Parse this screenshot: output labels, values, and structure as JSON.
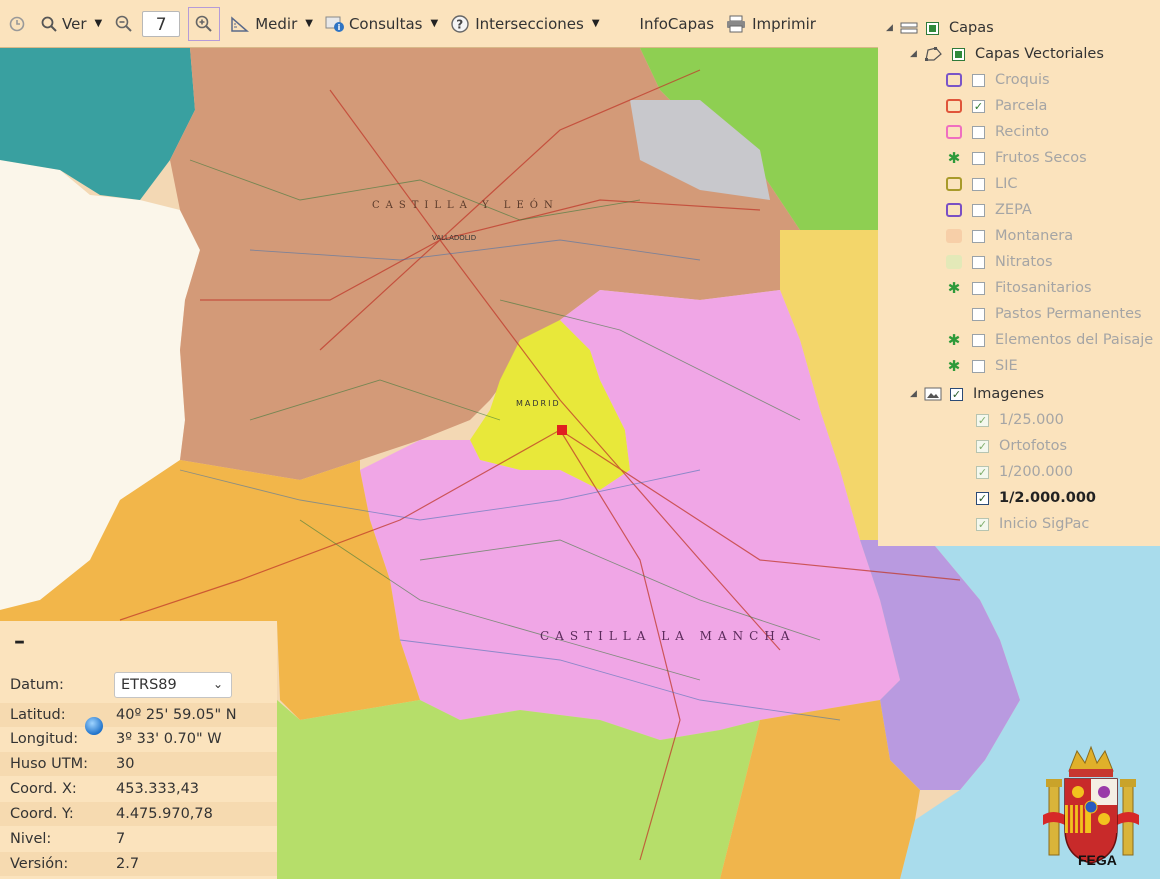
{
  "toolbar": {
    "ver_label": "Ver",
    "zoom_level": "7",
    "medir_label": "Medir",
    "consultas_label": "Consultas",
    "intersecciones_label": "Intersecciones",
    "infocapas_label": "InfoCapas",
    "imprimir_label": "Imprimir"
  },
  "layers": {
    "root_label": "Capas",
    "vector_group_label": "Capas Vectoriales",
    "vector_items": [
      {
        "label": "Croquis",
        "checked": false
      },
      {
        "label": "Parcela",
        "checked": true
      },
      {
        "label": "Recinto",
        "checked": false
      },
      {
        "label": "Frutos Secos",
        "checked": false
      },
      {
        "label": "LIC",
        "checked": false
      },
      {
        "label": "ZEPA",
        "checked": false
      },
      {
        "label": "Montanera",
        "checked": false
      },
      {
        "label": "Nitratos",
        "checked": false
      },
      {
        "label": "Fitosanitarios",
        "checked": false
      },
      {
        "label": "Pastos Permanentes",
        "checked": false
      },
      {
        "label": "Elementos del Paisaje",
        "checked": false
      },
      {
        "label": "SIE",
        "checked": false
      }
    ],
    "image_group_label": "Imagenes",
    "image_items": [
      {
        "label": "1/25.000",
        "checked": true,
        "active": false
      },
      {
        "label": "Ortofotos",
        "checked": true,
        "active": false
      },
      {
        "label": "1/200.000",
        "checked": true,
        "active": false
      },
      {
        "label": "1/2.000.000",
        "checked": true,
        "active": true
      },
      {
        "label": "Inicio SigPac",
        "checked": true,
        "active": false
      }
    ]
  },
  "info": {
    "collapse_symbol": "–",
    "datum_label": "Datum:",
    "datum_value": "ETRS89",
    "latitud_label": "Latitud:",
    "latitud_value": "40º 25' 59.05\" N",
    "longitud_label": "Longitud:",
    "longitud_value": "3º 33' 0.70\" W",
    "huso_label": "Huso UTM:",
    "huso_value": "30",
    "coordx_label": "Coord. X:",
    "coordx_value": "453.333,43",
    "coordy_label": "Coord. Y:",
    "coordy_value": "4.475.970,78",
    "nivel_label": "Nivel:",
    "nivel_value": "7",
    "version_label": "Versión:",
    "version_value": "2.7"
  },
  "map": {
    "labels": {
      "castilla_leon": "CASTILLA Y LEÓN",
      "castilla_mancha": "CASTILLA LA MANCHA",
      "madrid": "MADRID",
      "valladolid": "VALLADOLID"
    }
  },
  "logo": {
    "text": "FEGA"
  },
  "colors": {
    "panel_bg": "#fbe3bd",
    "castilla_leon": "#d39a78",
    "castilla_mancha": "#f0a6e6",
    "madrid": "#e8e83a",
    "extremadura": "#f2b64a",
    "portugal": "#fbf6ea",
    "sea": "#a9dcec",
    "valencia": "#b99ae0",
    "andalucia": "#b6de6a"
  }
}
